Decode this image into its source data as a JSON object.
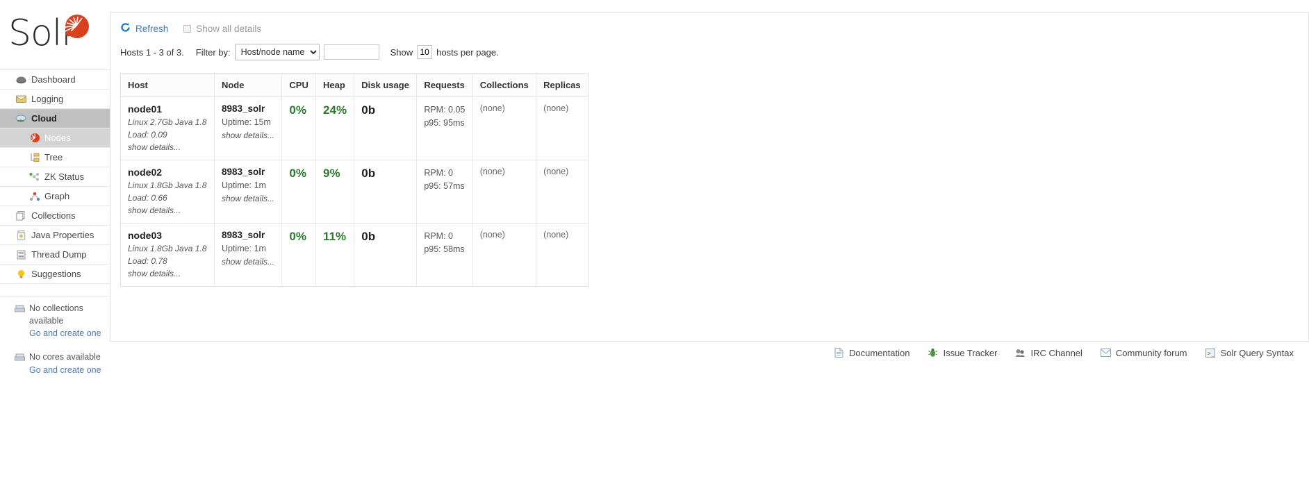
{
  "brand": {
    "name": "Solr",
    "logo_icon": "solr-sunburst-logo",
    "accent": "#d9411e"
  },
  "sidebar": {
    "items": [
      {
        "label": "Dashboard",
        "icon": "dashboard-icon",
        "active": false
      },
      {
        "label": "Logging",
        "icon": "logging-icon",
        "active": false
      },
      {
        "label": "Cloud",
        "icon": "cloud-icon",
        "active": true
      }
    ],
    "sub_items": [
      {
        "label": "Nodes",
        "icon": "nodes-icon",
        "active": true
      },
      {
        "label": "Tree",
        "icon": "tree-icon",
        "active": false
      },
      {
        "label": "ZK Status",
        "icon": "zk-status-icon",
        "active": false
      },
      {
        "label": "Graph",
        "icon": "graph-icon",
        "active": false
      }
    ],
    "items2": [
      {
        "label": "Collections",
        "icon": "collections-icon",
        "active": false
      },
      {
        "label": "Java Properties",
        "icon": "java-properties-icon",
        "active": false
      },
      {
        "label": "Thread Dump",
        "icon": "thread-dump-icon",
        "active": false
      },
      {
        "label": "Suggestions",
        "icon": "suggestions-icon",
        "active": false
      }
    ],
    "empty_collections": {
      "icon": "collection-empty-icon",
      "message": "No collections available",
      "action": "Go and create one"
    },
    "empty_cores": {
      "icon": "core-empty-icon",
      "message": "No cores available",
      "action": "Go and create one"
    }
  },
  "toolbar": {
    "refresh_label": "Refresh",
    "refresh_icon": "refresh-icon",
    "show_all_details_label": "Show all details",
    "show_all_details_checked": false
  },
  "filterbar": {
    "hosts_summary": "Hosts 1 - 3 of 3.",
    "filter_by_label": "Filter by:",
    "filter_selected": "Host/node name",
    "filter_options": [
      "Host/node name"
    ],
    "filter_value": "",
    "filter_placeholder": "",
    "show_label": "Show",
    "rows_per_page": "10",
    "per_page_label": "hosts per page."
  },
  "table": {
    "columns": [
      "Host",
      "Node",
      "CPU",
      "Heap",
      "Disk usage",
      "Requests",
      "Collections",
      "Replicas"
    ],
    "rows": [
      {
        "host_name": "node01",
        "host_meta": "Linux 2.7Gb Java 1.8",
        "host_load": "Load: 0.09",
        "host_details": "show details...",
        "node_port": "8983_solr",
        "node_uptime": "Uptime: 15m",
        "node_details": "show details...",
        "cpu": "0%",
        "heap": "24%",
        "disk": "0b",
        "requests_rpm": "RPM: 0.05",
        "requests_p95": "p95: 95ms",
        "collections": "(none)",
        "replicas": "(none)"
      },
      {
        "host_name": "node02",
        "host_meta": "Linux 1.8Gb Java 1.8",
        "host_load": "Load: 0.66",
        "host_details": "show details...",
        "node_port": "8983_solr",
        "node_uptime": "Uptime: 1m",
        "node_details": "show details...",
        "cpu": "0%",
        "heap": "9%",
        "disk": "0b",
        "requests_rpm": "RPM: 0",
        "requests_p95": "p95: 57ms",
        "collections": "(none)",
        "replicas": "(none)"
      },
      {
        "host_name": "node03",
        "host_meta": "Linux 1.8Gb Java 1.8",
        "host_load": "Load: 0.78",
        "host_details": "show details...",
        "node_port": "8983_solr",
        "node_uptime": "Uptime: 1m",
        "node_details": "show details...",
        "cpu": "0%",
        "heap": "11%",
        "disk": "0b",
        "requests_rpm": "RPM: 0",
        "requests_p95": "p95: 58ms",
        "collections": "(none)",
        "replicas": "(none)"
      }
    ]
  },
  "footer": {
    "links": [
      {
        "label": "Documentation",
        "icon": "document-icon"
      },
      {
        "label": "Issue Tracker",
        "icon": "bug-icon"
      },
      {
        "label": "IRC Channel",
        "icon": "chat-icon"
      },
      {
        "label": "Community forum",
        "icon": "mail-icon"
      },
      {
        "label": "Solr Query Syntax",
        "icon": "query-icon"
      }
    ]
  },
  "colors": {
    "green_metric": "#2d7a2d",
    "link_blue": "#3d7ab5",
    "active_nav": "#c0c0c0"
  }
}
